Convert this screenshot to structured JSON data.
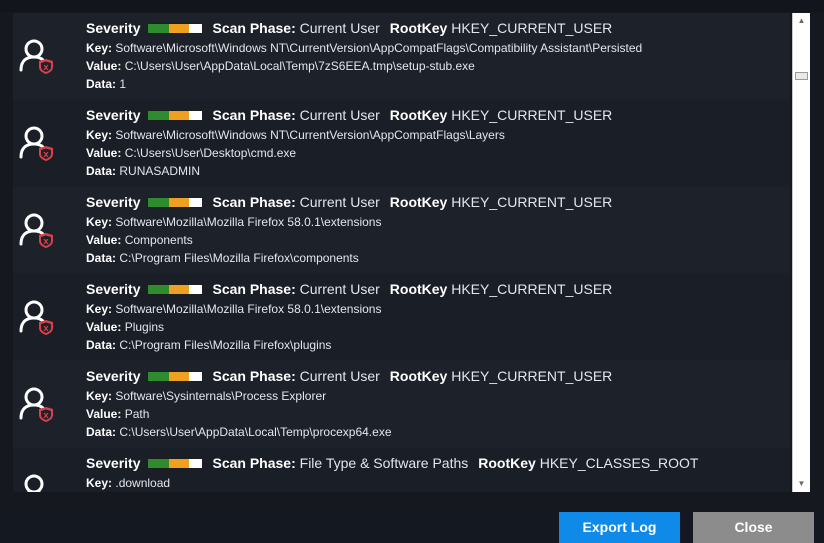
{
  "labels": {
    "severity": "Severity",
    "scan_phase": "Scan Phase:",
    "root_key": "RootKey",
    "key": "Key:",
    "value": "Value:",
    "data": "Data:"
  },
  "colors": {
    "severity_green": "#2e8b2e",
    "severity_yellow": "#f0a020",
    "export_button": "#0f8ae8",
    "close_button": "#8c8c8c"
  },
  "entries": [
    {
      "scan_phase": "Current User",
      "root_key": "HKEY_CURRENT_USER",
      "key": "Software\\Microsoft\\Windows NT\\CurrentVersion\\AppCompatFlags\\Compatibility Assistant\\Persisted",
      "value": "C:\\Users\\User\\AppData\\Local\\Temp\\7zS6EEA.tmp\\setup-stub.exe",
      "data": "1"
    },
    {
      "scan_phase": "Current User",
      "root_key": "HKEY_CURRENT_USER",
      "key": "Software\\Microsoft\\Windows NT\\CurrentVersion\\AppCompatFlags\\Layers",
      "value": "C:\\Users\\User\\Desktop\\cmd.exe",
      "data": "RUNASADMIN"
    },
    {
      "scan_phase": "Current User",
      "root_key": "HKEY_CURRENT_USER",
      "key": "Software\\Mozilla\\Mozilla Firefox 58.0.1\\extensions",
      "value": "Components",
      "data": "C:\\Program Files\\Mozilla Firefox\\components"
    },
    {
      "scan_phase": "Current User",
      "root_key": "HKEY_CURRENT_USER",
      "key": "Software\\Mozilla\\Mozilla Firefox 58.0.1\\extensions",
      "value": "Plugins",
      "data": "C:\\Program Files\\Mozilla Firefox\\plugins"
    },
    {
      "scan_phase": "Current User",
      "root_key": "HKEY_CURRENT_USER",
      "key": "Software\\Sysinternals\\Process Explorer",
      "value": "Path",
      "data": "C:\\Users\\User\\AppData\\Local\\Temp\\procexp64.exe"
    },
    {
      "scan_phase": "File Type & Software Paths",
      "root_key": "HKEY_CLASSES_ROOT",
      "key": ".download",
      "value": "",
      "data": ""
    }
  ],
  "buttons": {
    "export": "Export Log",
    "close": "Close"
  }
}
